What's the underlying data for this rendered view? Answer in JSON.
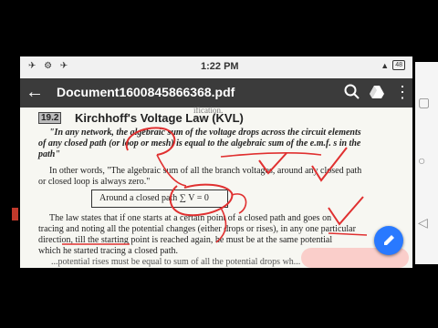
{
  "status_bar": {
    "time": "1:22 PM",
    "left_icons": "✈ ⚙ ✈",
    "battery": "48"
  },
  "toolbar": {
    "title": "Document1600845866368.pdf"
  },
  "icons": {
    "back": "back-arrow-icon",
    "search": "search-icon",
    "drive": "drive-icon",
    "more": "more-vert-icon"
  },
  "document": {
    "previous_text": "ification.",
    "section_number": "19.2",
    "section_title": "Kirchhoff's Voltage Law (KVL)",
    "definition": [
      "\"In any network, the algebraic sum of the voltage drops across the circuit elements",
      "of any closed path (or loop or mesh) is equal to the algebraic sum of the e.m.f. s in the",
      "path\""
    ],
    "other_words": [
      "In other words, \"The algebraic sum of all the branch voltages, around any closed path",
      "or closed loop is always zero.\""
    ],
    "boxed": "Around a closed path  ∑ V = 0",
    "law_text": [
      "The law states that if one starts at a certain point of a closed path and goes on",
      "tracing and noting all the potential changes (either drops or rises), in any one particular",
      "direction, till the starting point is reached again, he must be at the same potential",
      "which he started tracing a closed path."
    ],
    "cut_line": "...potential rises must be equal to sum of all the potential drops wh..."
  },
  "colors": {
    "annotation": "#e03030",
    "toolbar": "#3b3b3b",
    "fab": "#2979ff"
  }
}
